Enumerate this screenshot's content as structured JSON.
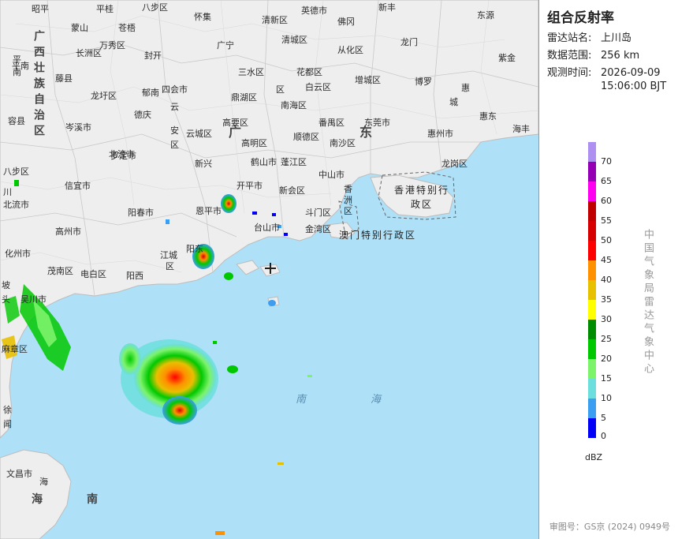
{
  "panel": {
    "title": "组合反射率",
    "station_label": "雷达站名:",
    "station_value": "上川岛",
    "range_label": "数据范围:",
    "range_value": "256 km",
    "time_label": "观测时间:",
    "time_value_date": "2026-09-09",
    "time_value_clock": "15:06:00 BJT",
    "unit": "dBZ",
    "agency": "中国气象局雷达气象中心",
    "approval": "审图号：GS京 (2024) 0949号"
  },
  "legend": {
    "levels": [
      {
        "label": "70",
        "color": "#ad90f0"
      },
      {
        "label": "65",
        "color": "#9600b4"
      },
      {
        "label": "60",
        "color": "#ff00f0"
      },
      {
        "label": "55",
        "color": "#c00000"
      },
      {
        "label": "50",
        "color": "#d60000"
      },
      {
        "label": "45",
        "color": "#ff0000"
      },
      {
        "label": "40",
        "color": "#ff9000"
      },
      {
        "label": "35",
        "color": "#e7c000"
      },
      {
        "label": "30",
        "color": "#ffff00"
      },
      {
        "label": "25",
        "color": "#008c00"
      },
      {
        "label": "20",
        "color": "#00c800"
      },
      {
        "label": "15",
        "color": "#7cf36a"
      },
      {
        "label": "10",
        "color": "#6cdede"
      },
      {
        "label": "5",
        "color": "#3c9ef0"
      },
      {
        "label": "0",
        "color": "#0000f6"
      }
    ]
  },
  "map": {
    "land_color": "#eeeeee",
    "sea_color": "#aee0f8",
    "places": [
      {
        "id": "zhaoping",
        "text": "昭平"
      },
      {
        "id": "pingle",
        "text": "平桂"
      },
      {
        "id": "babu",
        "text": "八步区"
      },
      {
        "id": "huaiji",
        "text": "怀集"
      },
      {
        "id": "qingxin",
        "text": "清新区"
      },
      {
        "id": "yingde",
        "text": "英德市"
      },
      {
        "id": "xinfeng",
        "text": "新丰"
      },
      {
        "id": "dongyuan",
        "text": "东源"
      },
      {
        "id": "mengshan",
        "text": "蒙山"
      },
      {
        "id": "cangwu",
        "text": "苍梧"
      },
      {
        "id": "changzhou",
        "text": "长洲区"
      },
      {
        "id": "wanxiu",
        "text": "万秀区"
      },
      {
        "id": "fengkai",
        "text": "封开"
      },
      {
        "id": "guangning",
        "text": "广宁"
      },
      {
        "id": "qingcheng",
        "text": "清城区"
      },
      {
        "id": "fogang",
        "text": "佛冈"
      },
      {
        "id": "conghua",
        "text": "从化区"
      },
      {
        "id": "longmen",
        "text": "龙门"
      },
      {
        "id": "zijin",
        "text": "紫金"
      },
      {
        "id": "pingnan",
        "text": "平南"
      },
      {
        "id": "tengxian",
        "text": "藤县"
      },
      {
        "id": "sihui",
        "text": "四会市"
      },
      {
        "id": "sanshui",
        "text": "三水区"
      },
      {
        "id": "huadu",
        "text": "花都区"
      },
      {
        "id": "baiyun",
        "text": "白云区"
      },
      {
        "id": "zengcheng",
        "text": "增城区"
      },
      {
        "id": "boluo",
        "text": "博罗"
      },
      {
        "id": "huiyang",
        "text": "惠"
      },
      {
        "id": "huicheng",
        "text": "城"
      },
      {
        "id": "huidong",
        "text": "惠东"
      },
      {
        "id": "haifeng",
        "text": "海丰"
      },
      {
        "id": "rongxian",
        "text": "容县"
      },
      {
        "id": "cenxi",
        "text": "岑溪市"
      },
      {
        "id": "longxu",
        "text": "龙圩区"
      },
      {
        "id": "deqing",
        "text": "德庆"
      },
      {
        "id": "dinghu",
        "text": "鼎湖区"
      },
      {
        "id": "nanhai",
        "text": "南海区"
      },
      {
        "id": "qu",
        "text": "区"
      },
      {
        "id": "gaoyao",
        "text": "高要区"
      },
      {
        "id": "panyu",
        "text": "番禺区"
      },
      {
        "id": "dongguan",
        "text": "东莞市"
      },
      {
        "id": "huizhou",
        "text": "惠州市"
      },
      {
        "id": "beiliu",
        "text": "北流市"
      },
      {
        "id": "yunan",
        "text": "郁南"
      },
      {
        "id": "yunan2",
        "text": "云"
      },
      {
        "id": "yunan3",
        "text": "安"
      },
      {
        "id": "yunan4",
        "text": "区"
      },
      {
        "id": "luoding",
        "text": "罗定市"
      },
      {
        "id": "gaoming",
        "text": "高明区"
      },
      {
        "id": "shunde",
        "text": "顺德区"
      },
      {
        "id": "nansha",
        "text": "南沙区"
      },
      {
        "id": "shenzhen_lg",
        "text": "龙岗区"
      },
      {
        "id": "yunfeng",
        "text": "云城区"
      },
      {
        "id": "xinxing",
        "text": "新兴"
      },
      {
        "id": "heshan",
        "text": "鹤山市"
      },
      {
        "id": "pengjiang",
        "text": "蓬江区"
      },
      {
        "id": "zhongshan",
        "text": "中山市"
      },
      {
        "id": "beiliu2",
        "text": "北流市"
      },
      {
        "id": "xinyi",
        "text": "信宜市"
      },
      {
        "id": "kaiping",
        "text": "开平市"
      },
      {
        "id": "xinhui",
        "text": "新会区"
      },
      {
        "id": "xiangzhou",
        "text": "香"
      },
      {
        "id": "xiangzhou2",
        "text": "洲"
      },
      {
        "id": "xiangzhou3",
        "text": "区"
      },
      {
        "id": "yangchun",
        "text": "阳春市"
      },
      {
        "id": "enping",
        "text": "恩平市"
      },
      {
        "id": "doumen",
        "text": "斗门区"
      },
      {
        "id": "taishan",
        "text": "台山市"
      },
      {
        "id": "jinwan",
        "text": "金湾区"
      },
      {
        "id": "gaozhou",
        "text": "高州市"
      },
      {
        "id": "jiangcheng",
        "text": "江城"
      },
      {
        "id": "jiangcheng2",
        "text": "区"
      },
      {
        "id": "yangdong",
        "text": "阳东"
      },
      {
        "id": "huazhou",
        "text": "化州市"
      },
      {
        "id": "maonan",
        "text": "茂南区"
      },
      {
        "id": "dianbai",
        "text": "电白区"
      },
      {
        "id": "yangxi",
        "text": "阳西"
      },
      {
        "id": "wuchuan",
        "text": "吴川市"
      },
      {
        "id": "potou",
        "text": "坡"
      },
      {
        "id": "potou2",
        "text": "头"
      },
      {
        "id": "mazhang",
        "text": "麻章区"
      },
      {
        "id": "xuwen",
        "text": "徐"
      },
      {
        "id": "xuwen2",
        "text": "闻"
      },
      {
        "id": "pingnan2",
        "text": "平"
      },
      {
        "id": "pingnan3",
        "text": "南"
      },
      {
        "id": "tengxian2",
        "text": "藤县"
      },
      {
        "id": "rong",
        "text": "容县"
      },
      {
        "id": "lu",
        "text": "陆"
      },
      {
        "id": "chuan",
        "text": "川"
      },
      {
        "id": "yulin",
        "text": "北流市"
      },
      {
        "id": "qiong",
        "text": "琼"
      },
      {
        "id": "wen",
        "text": "文昌市"
      },
      {
        "id": "hai2",
        "text": "海"
      },
      {
        "id": "nan2",
        "text": "南"
      }
    ],
    "big_labels": [
      {
        "id": "guangxi",
        "text": "广西壮族自治区"
      },
      {
        "id": "guang",
        "text": "广"
      },
      {
        "id": "dong",
        "text": "东"
      },
      {
        "id": "hk",
        "text": "香港特别行政区"
      },
      {
        "id": "macao",
        "text": "澳门特别行政区"
      },
      {
        "id": "southsea1",
        "text": "南"
      },
      {
        "id": "southsea2",
        "text": "海"
      },
      {
        "id": "hainan1",
        "text": "海"
      },
      {
        "id": "hainan2",
        "text": "南"
      }
    ]
  }
}
